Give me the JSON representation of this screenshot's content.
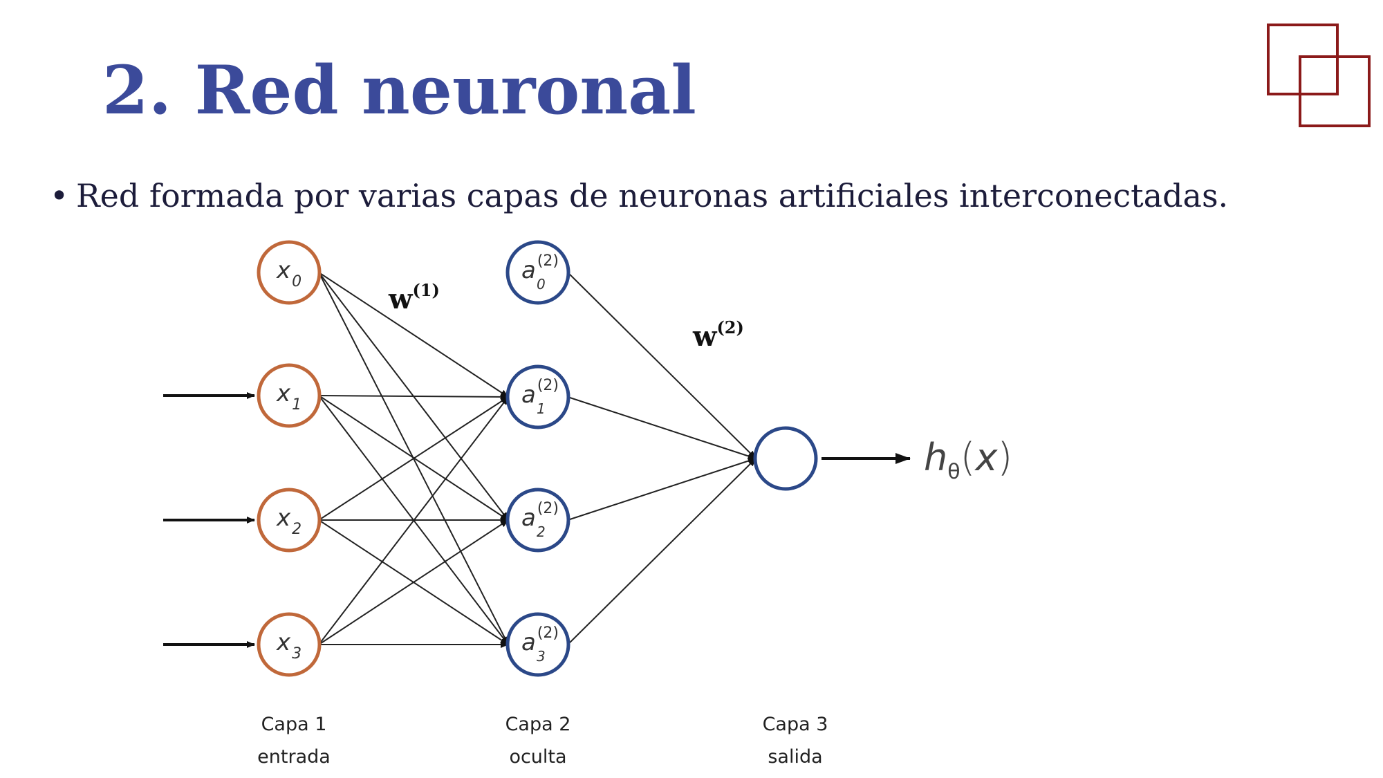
{
  "slide": {
    "title": "2. Red neuronal",
    "bullet": "Red formada por varias capas de neuronas artificiales interconectadas."
  },
  "diagram": {
    "weights": [
      {
        "symbol": "w",
        "superscript": "(1)"
      },
      {
        "symbol": "w",
        "superscript": "(2)"
      }
    ],
    "layers": [
      {
        "name": "Capa 1",
        "role": "entrada",
        "color": "#c0683a",
        "nodes": [
          {
            "base": "x",
            "sub": "0"
          },
          {
            "base": "x",
            "sub": "1"
          },
          {
            "base": "x",
            "sub": "2"
          },
          {
            "base": "x",
            "sub": "3"
          }
        ]
      },
      {
        "name": "Capa 2",
        "role": "oculta",
        "color": "#2b4888",
        "nodes": [
          {
            "base": "a",
            "sub": "0",
            "sup": "(2)"
          },
          {
            "base": "a",
            "sub": "1",
            "sup": "(2)"
          },
          {
            "base": "a",
            "sub": "2",
            "sup": "(2)"
          },
          {
            "base": "a",
            "sub": "3",
            "sup": "(2)"
          }
        ]
      },
      {
        "name": "Capa 3",
        "role": "salida",
        "color": "#2b4888",
        "nodes": [
          {
            "base": "",
            "sub": ""
          }
        ]
      }
    ],
    "output": {
      "base": "h",
      "sub": "θ",
      "arg": "x"
    }
  },
  "colors": {
    "title": "#3b4a9a",
    "text": "#1c1c3a",
    "logo": "#8b1a1a",
    "edge": "#222222"
  }
}
